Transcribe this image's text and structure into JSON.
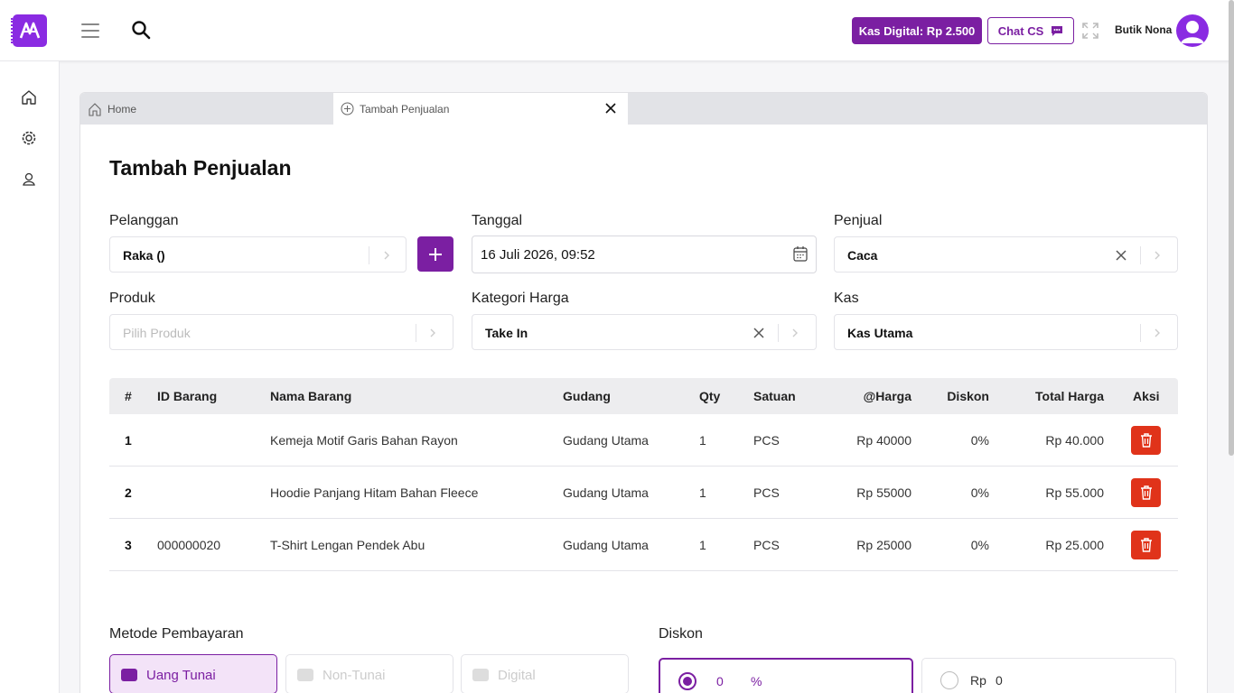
{
  "header": {
    "kas_digital": "Kas Digital: Rp 2.500",
    "chat_cs": "Chat CS",
    "user_name": "Butik Nona"
  },
  "tabs": {
    "home": "Home",
    "active": "Tambah Penjualan"
  },
  "form": {
    "title": "Tambah Penjualan",
    "pelanggan_label": "Pelanggan",
    "pelanggan_value": "Raka ()",
    "tanggal_label": "Tanggal",
    "tanggal_value": "16 Juli 2026, 09:52",
    "penjual_label": "Penjual",
    "penjual_value": "Caca",
    "produk_label": "Produk",
    "produk_placeholder": "Pilih Produk",
    "kategori_label": "Kategori Harga",
    "kategori_value": "Take In",
    "kas_label": "Kas",
    "kas_value": "Kas Utama"
  },
  "table": {
    "headers": {
      "no": "#",
      "id": "ID Barang",
      "nama": "Nama Barang",
      "gudang": "Gudang",
      "qty": "Qty",
      "satuan": "Satuan",
      "harga": "@Harga",
      "diskon": "Diskon",
      "total": "Total Harga",
      "aksi": "Aksi"
    },
    "rows": [
      {
        "no": "1",
        "id": "",
        "nama": "Kemeja Motif Garis Bahan Rayon",
        "gudang": "Gudang Utama",
        "qty": "1",
        "satuan": "PCS",
        "harga": "Rp 40000",
        "diskon": "0%",
        "total": "Rp 40.000"
      },
      {
        "no": "2",
        "id": "",
        "nama": "Hoodie Panjang Hitam Bahan Fleece",
        "gudang": "Gudang Utama",
        "qty": "1",
        "satuan": "PCS",
        "harga": "Rp 55000",
        "diskon": "0%",
        "total": "Rp 55.000"
      },
      {
        "no": "3",
        "id": "000000020",
        "nama": "T-Shirt Lengan Pendek Abu",
        "gudang": "Gudang Utama",
        "qty": "1",
        "satuan": "PCS",
        "harga": "Rp 25000",
        "diskon": "0%",
        "total": "Rp 25.000"
      }
    ]
  },
  "payment": {
    "label": "Metode Pembayaran",
    "methods": [
      "Uang Tunai",
      "Non-Tunai",
      "Digital"
    ],
    "selected": "Uang Tunai"
  },
  "discount": {
    "label": "Diskon",
    "percent_value": "0",
    "percent_unit": "%",
    "rp_unit": "Rp",
    "rp_value": "0"
  },
  "colors": {
    "primary": "#7b1fa2",
    "danger": "#e0331a"
  }
}
